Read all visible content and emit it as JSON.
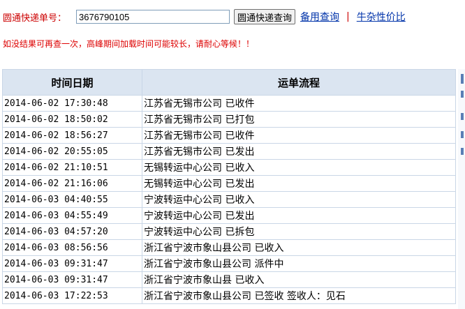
{
  "search": {
    "label": "圆通快递单号：",
    "value": "3676790105",
    "button_label": "圆通快递查询"
  },
  "links": {
    "backup": "备用查询",
    "separator": "|",
    "price": "牛杂性价比"
  },
  "notice": "如没结果可再查一次，高峰期间加载时间可能较长，请耐心等候！！",
  "table": {
    "headers": [
      "时间日期",
      "运单流程"
    ],
    "rows": [
      {
        "time": "2014-06-02 17:30:48",
        "flow": "江苏省无锡市公司 已收件"
      },
      {
        "time": "2014-06-02 18:50:02",
        "flow": "江苏省无锡市公司 已打包"
      },
      {
        "time": "2014-06-02 18:56:27",
        "flow": "江苏省无锡市公司 已收件"
      },
      {
        "time": "2014-06-02 20:55:05",
        "flow": "江苏省无锡市公司 已发出"
      },
      {
        "time": "2014-06-02 21:10:51",
        "flow": "无锡转运中心公司 已收入"
      },
      {
        "time": "2014-06-02 21:16:06",
        "flow": "无锡转运中心公司 已发出"
      },
      {
        "time": "2014-06-03 04:40:55",
        "flow": "宁波转运中心公司 已收入"
      },
      {
        "time": "2014-06-03 04:55:49",
        "flow": "宁波转运中心公司 已发出"
      },
      {
        "time": "2014-06-03 04:57:20",
        "flow": "宁波转运中心公司 已拆包"
      },
      {
        "time": "2014-06-03 08:56:56",
        "flow": "浙江省宁波市象山县公司 已收入"
      },
      {
        "time": "2014-06-03 09:31:47",
        "flow": "浙江省宁波市象山县公司 派件中"
      },
      {
        "time": "2014-06-03 09:31:47",
        "flow": "浙江省宁波市象山县 已收入"
      },
      {
        "time": "2014-06-03 17:22:53",
        "flow": "浙江省宁波市象山县公司 已签收 签收人：见石"
      }
    ]
  },
  "colors": {
    "label_red": "#cc0000",
    "link_blue": "#0033aa",
    "header_bg": "#dbe5f1",
    "border": "#c9d6e6"
  }
}
